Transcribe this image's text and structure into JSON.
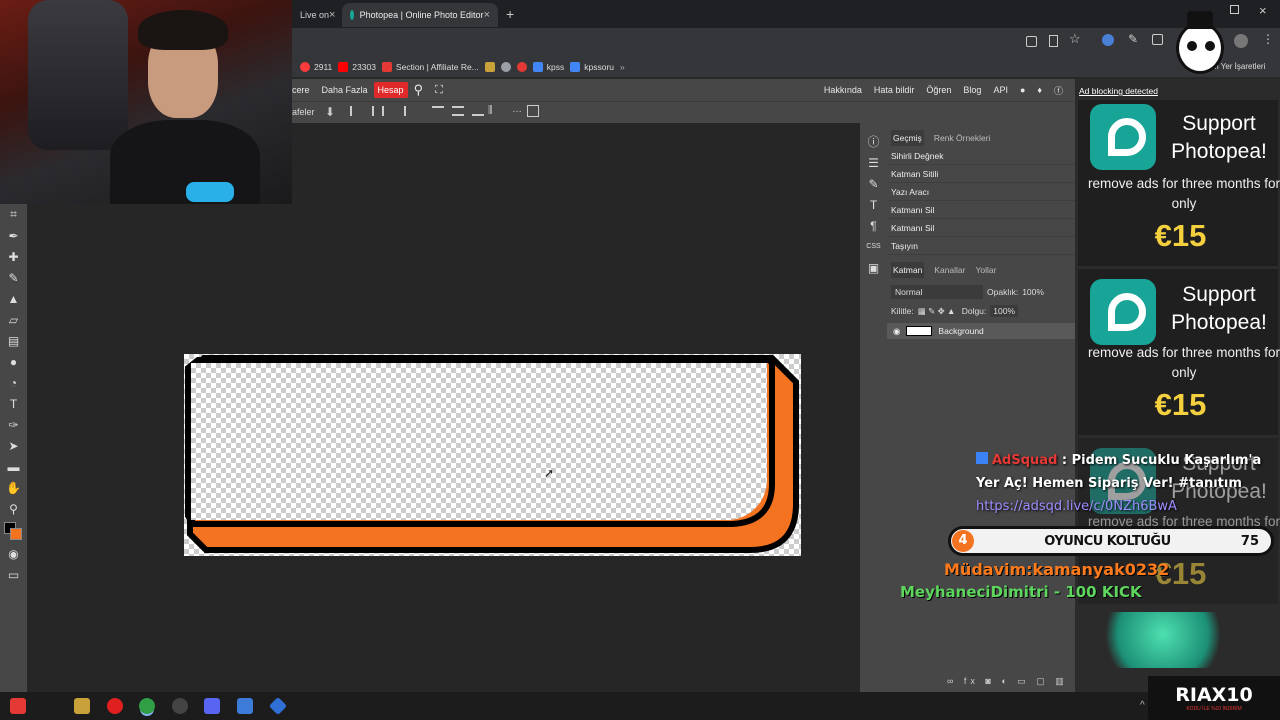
{
  "browser": {
    "tab_prev_fragment": "Live on",
    "tab_active_label": "Photopea | Online Photo Editor",
    "new_tab_symbol": "+",
    "close_symbol": "×",
    "bookmarks": [
      {
        "label": "2911",
        "color": "#ff3b3b"
      },
      {
        "label": "23303",
        "color": "#ff0000"
      },
      {
        "label": "Section | Affiliate Re...",
        "color": "#e53935"
      },
      {
        "label": "",
        "color": "#c8a13a"
      },
      {
        "label": "",
        "color": "#9aa0a6"
      },
      {
        "label": "",
        "color": "#e53935"
      },
      {
        "label": "kpss",
        "color": "#4285f4"
      },
      {
        "label": "kpssoru",
        "color": "#4285f4"
      }
    ],
    "bookmarks_right_label": "m Yer İşaretleri"
  },
  "photopea": {
    "menu_left": [
      "cere",
      "Daha Fazla"
    ],
    "menu_account": "Hesap",
    "menu_right": [
      "Hakkında",
      "Hata bildir",
      "Öğren",
      "Blog",
      "API"
    ],
    "toolbar_label": "afeler",
    "history_tabs": [
      "Geçmiş",
      "Renk Örnekleri"
    ],
    "history_items": [
      "Sihirli Değnek",
      "Katman Sitili",
      "Yazı Aracı",
      "Katmanı Sil",
      "Katmanı Sil",
      "Taşıyın"
    ],
    "layer_tabs": [
      "Katman",
      "Kanallar",
      "Yollar"
    ],
    "blend_mode": "Normal",
    "opacity_label": "Opaklık:",
    "opacity_value": "100%",
    "lock_label": "Kilitle:",
    "fill_label": "Dolgu:",
    "fill_value": "100%",
    "layer_name": "Background",
    "ad_blocking_label": "Ad blocking detected"
  },
  "ads": [
    {
      "title": "Support Photopea!",
      "subtitle": "remove ads for three months for only",
      "price": "€15"
    },
    {
      "title": "Support Photopea!",
      "subtitle": "remove ads for three months for only",
      "price": "€15"
    },
    {
      "title": "Support Photopea!",
      "subtitle": "remove ads for three months for only",
      "price": "€15"
    }
  ],
  "stream_overlay": {
    "adsquad_brand": "AdSquad",
    "adsquad_message": " : Pidem Sucuklu Kaşarlım'a Yer Aç! Hemen Sipariş Ver! #tanıtım",
    "adsquad_link": "https://adsqd.live/c/0NZh6BwA",
    "goal_left": "4",
    "goal_title": "OYUNCU KOLTUĞU",
    "goal_right": "75",
    "ticker_1": "Müdavim:kamanyak0232",
    "ticker_2": "MeyhaneciDimitri - 100 KICK",
    "logo_name": "RIAX10",
    "logo_sub": "KODU İLE %10 İNDİRİM"
  },
  "colors": {
    "orange_frame": "#f47321",
    "accent_red": "#e02a2a",
    "price_yellow": "#f4d03f",
    "teal_logo": "#18a497"
  }
}
